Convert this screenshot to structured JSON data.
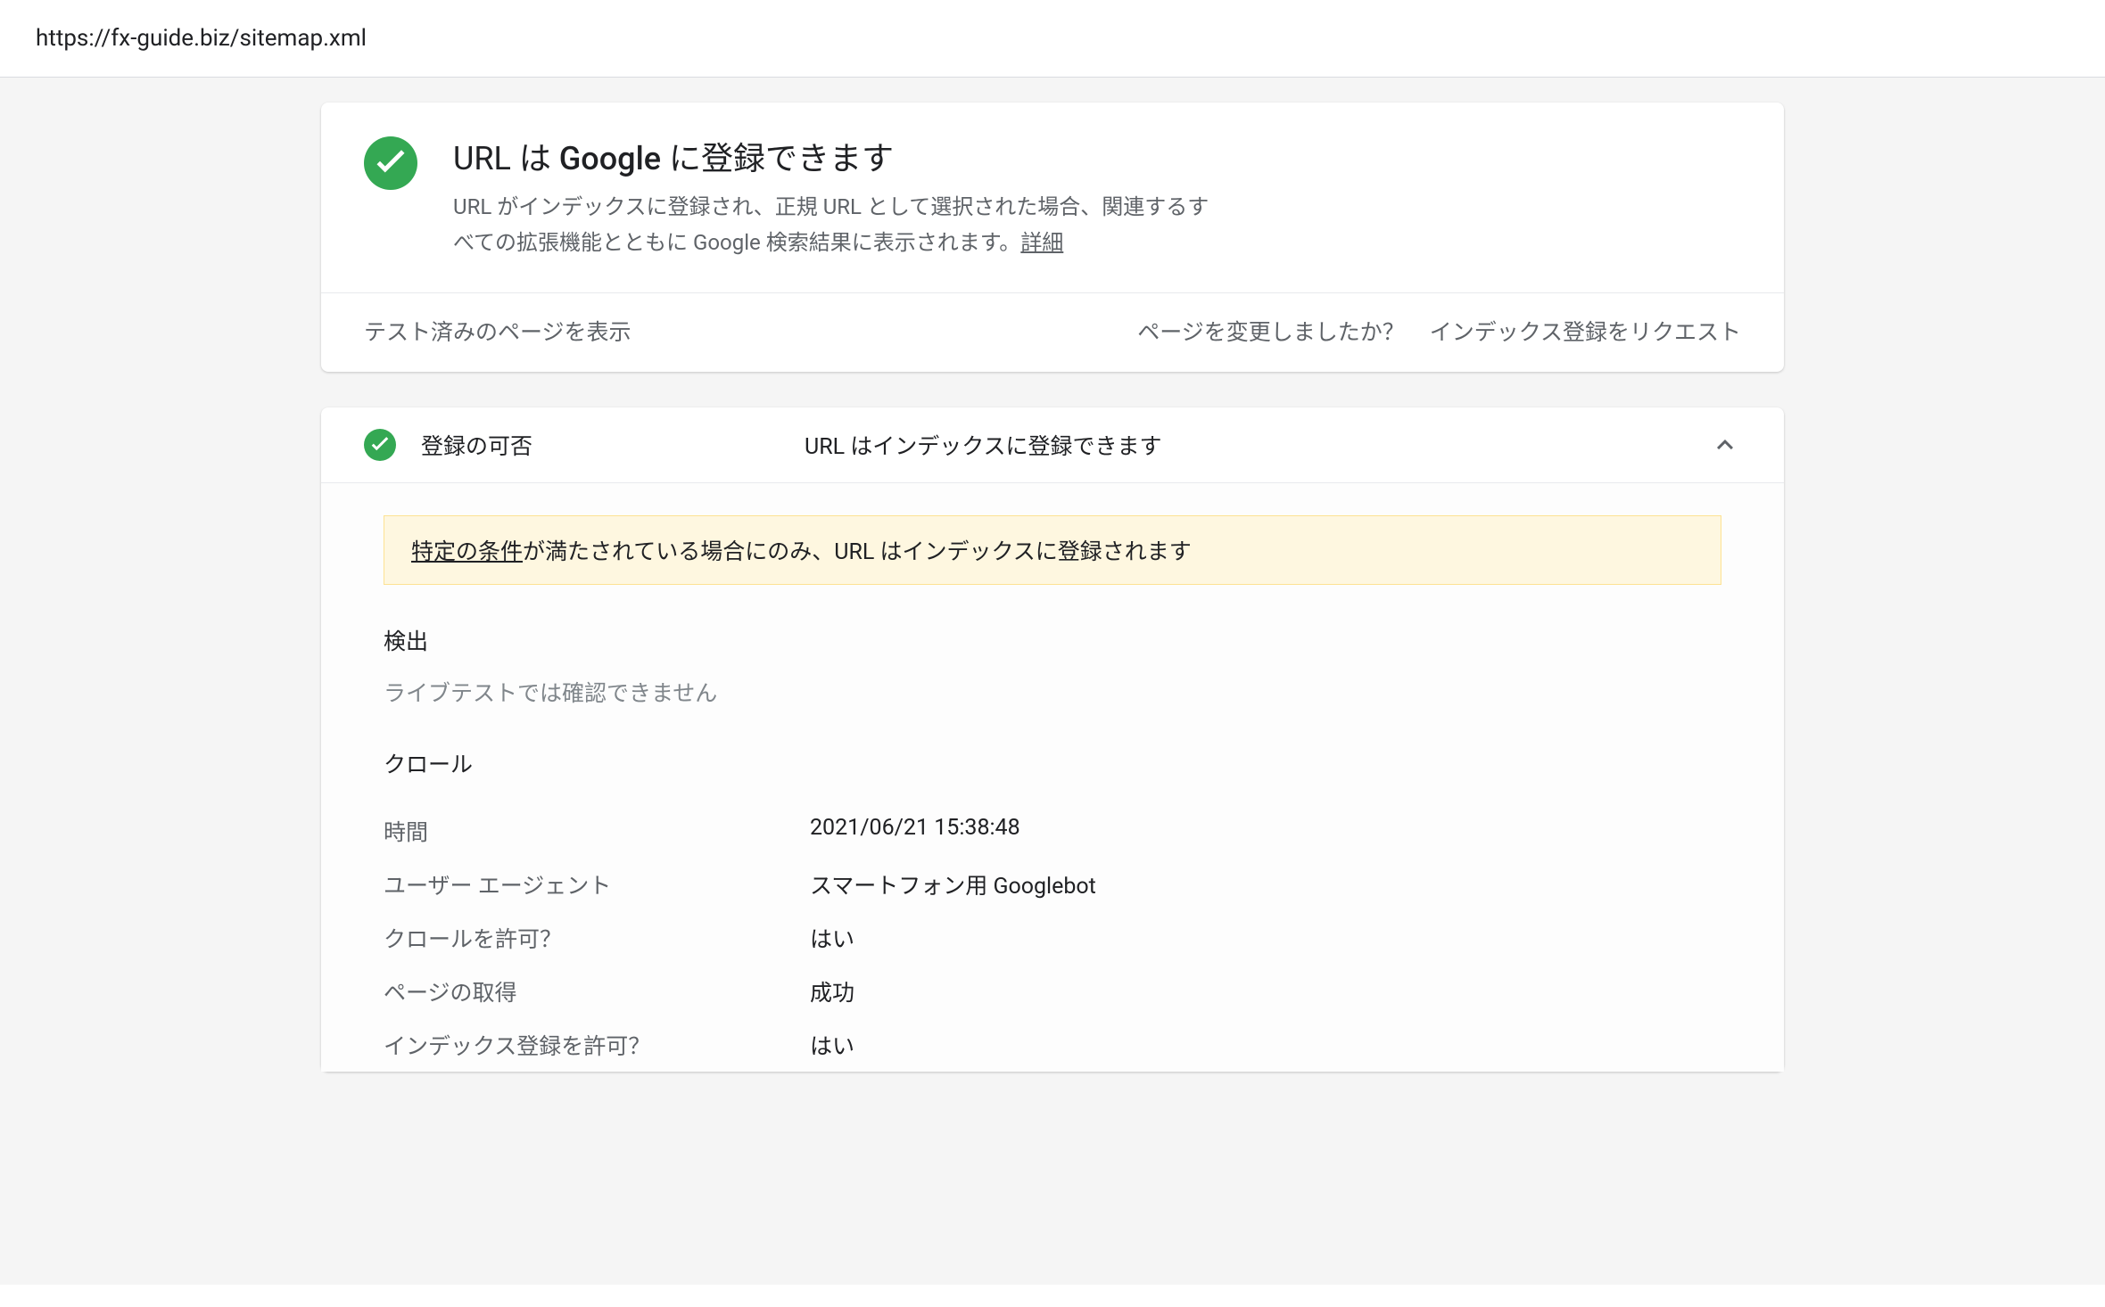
{
  "urlBar": "https://fx-guide.biz/sitemap.xml",
  "status": {
    "title_prefix": "URL は ",
    "title_bold": "Google",
    "title_suffix": " に登録できます",
    "desc_line1": "URL がインデックスに登録され、正規 URL として選択された場合、関連するす",
    "desc_line2_a": "べての拡張機能とともに Google 検索結果に表示されます。",
    "desc_link": "詳細"
  },
  "actions": {
    "viewTested": "テスト済みのページを表示",
    "pageChanged": "ページを変更しましたか？",
    "requestIndex": "インデックス登録をリクエスト"
  },
  "coverage": {
    "label": "登録の可否",
    "value": "URL はインデックスに登録できます",
    "notice_underline": "特定の条件",
    "notice_rest": "が満たされている場合にのみ、URL はインデックスに登録されます",
    "discovery": {
      "title": "検出",
      "text": "ライブテストでは確認できません"
    },
    "crawl": {
      "title": "クロール",
      "rows": [
        {
          "key": "時間",
          "val": "2021/06/21 15:38:48"
        },
        {
          "key": "ユーザー エージェント",
          "val": "スマートフォン用 Googlebot"
        },
        {
          "key": "クロールを許可？",
          "val": "はい"
        },
        {
          "key": "ページの取得",
          "val": "成功"
        },
        {
          "key": "インデックス登録を許可？",
          "val": "はい"
        }
      ]
    }
  },
  "colors": {
    "successGreen": "#34a853"
  }
}
